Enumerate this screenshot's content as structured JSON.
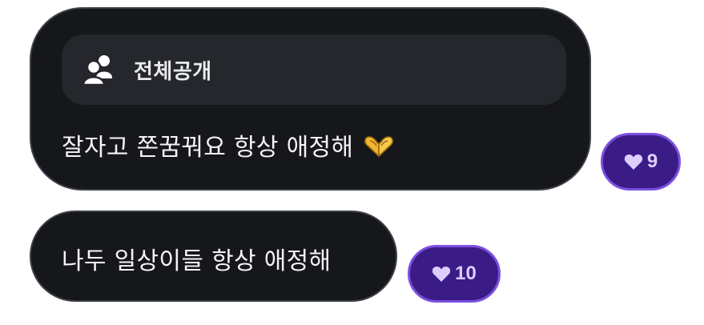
{
  "messages": [
    {
      "visibility": "전체공개",
      "visibility_icon": "people-icon",
      "text": "잘자고 쫀꿈꿔요 항상 애정해",
      "emoji": "heart-hands-emoji",
      "likes": "9"
    },
    {
      "text": "나두 일상이들 항상 애정해",
      "likes": "10"
    }
  ],
  "colors": {
    "bubble_bg": "#16171b",
    "bubble_border": "#3c3f48",
    "chip_bg": "#25272d",
    "badge_bg": "#3b1b86",
    "badge_border": "#7b4fe0",
    "badge_text": "#dccdff"
  }
}
